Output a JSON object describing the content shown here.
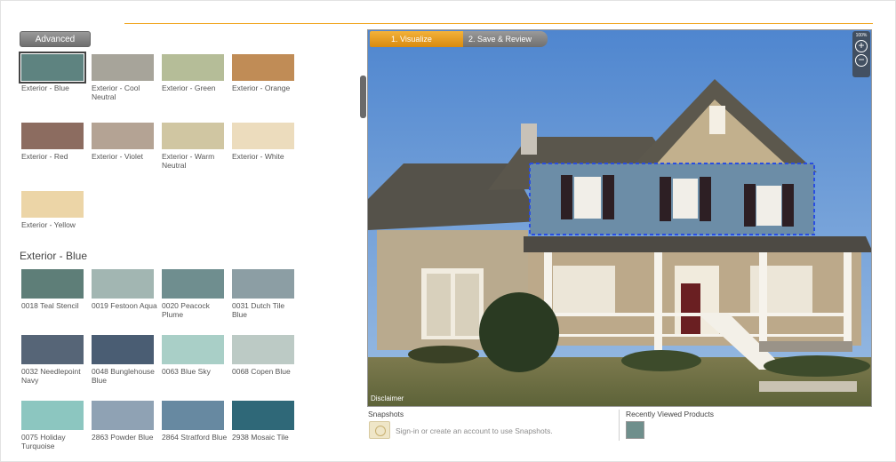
{
  "advanced_button": "Advanced",
  "categories": [
    {
      "label": "Exterior - Blue",
      "color": "#5e8380",
      "selected": true
    },
    {
      "label": "Exterior - Cool Neutral",
      "color": "#a7a49a"
    },
    {
      "label": "Exterior - Green",
      "color": "#b5bd98"
    },
    {
      "label": "Exterior - Orange",
      "color": "#c08c56"
    },
    {
      "label": "Exterior - Red",
      "color": "#8c6c60"
    },
    {
      "label": "Exterior - Violet",
      "color": "#b4a394"
    },
    {
      "label": "Exterior - Warm Neutral",
      "color": "#d0c6a2"
    },
    {
      "label": "Exterior - White",
      "color": "#ecdcbd"
    },
    {
      "label": "Exterior - Yellow",
      "color": "#ecd5a7"
    }
  ],
  "section_title": "Exterior - Blue",
  "products": [
    {
      "label": "0018 Teal Stencil",
      "color": "#5e7e78"
    },
    {
      "label": "0019 Festoon Aqua",
      "color": "#a2b6b2"
    },
    {
      "label": "0020 Peacock Plume",
      "color": "#6f8e8f"
    },
    {
      "label": "0031 Dutch Tile Blue",
      "color": "#8c9ea4"
    },
    {
      "label": "0032 Needlepoint Navy",
      "color": "#566577"
    },
    {
      "label": "0048 Bunglehouse Blue",
      "color": "#4a5d73"
    },
    {
      "label": "0063 Blue Sky",
      "color": "#a9cfc7"
    },
    {
      "label": "0068 Copen Blue",
      "color": "#bccac5"
    },
    {
      "label": "0075 Holiday Turquoise",
      "color": "#8cc6c0"
    },
    {
      "label": "2863 Powder Blue",
      "color": "#8fa2b4"
    },
    {
      "label": "2864 Stratford Blue",
      "color": "#6789a1"
    },
    {
      "label": "2938 Mosaic Tile",
      "color": "#2f6878"
    }
  ],
  "tabs": [
    {
      "label": "1. Visualize",
      "active": true
    },
    {
      "label": "2. Save & Review",
      "active": false
    }
  ],
  "zoom": {
    "percent": "100%",
    "zoom_in": "+",
    "zoom_out": "−"
  },
  "disclaimer": "Disclaimer",
  "snapshots": {
    "title": "Snapshots",
    "text": "Sign-in or create an account to use Snapshots."
  },
  "recent": {
    "title": "Recently Viewed Products",
    "thumb_color": "#6f8f8c"
  },
  "colors": {
    "accent": "#f0a41e",
    "selection_outline": "#2a4ee0"
  }
}
